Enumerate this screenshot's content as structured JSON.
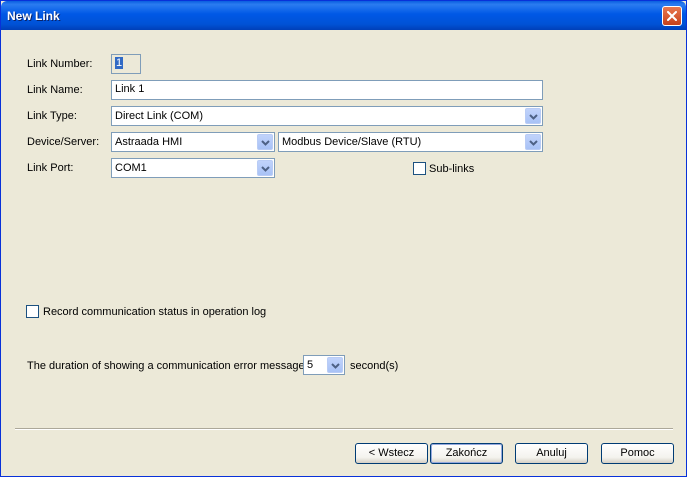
{
  "window": {
    "title": "New Link"
  },
  "form": {
    "link_number": {
      "label": "Link Number:",
      "value": "1"
    },
    "link_name": {
      "label": "Link Name:",
      "value": "Link 1"
    },
    "link_type": {
      "label": "Link Type:",
      "value": "Direct Link (COM)"
    },
    "device_server": {
      "label": "Device/Server:",
      "device": "Astraada HMI",
      "protocol": "Modbus Device/Slave (RTU)"
    },
    "link_port": {
      "label": "Link Port:",
      "value": "COM1"
    },
    "sub_links": {
      "label": "Sub-links",
      "checked": false
    },
    "record_status": {
      "label": "Record communication status in operation log",
      "checked": false
    },
    "error_duration": {
      "label": "The duration of showing a communication error message:",
      "value": "5",
      "unit": "second(s)"
    }
  },
  "buttons": {
    "back": "< Wstecz",
    "finish": "Zakończ",
    "cancel": "Anuluj",
    "help": "Pomoc"
  },
  "icons": {
    "close": "close-icon",
    "dropdown": "chevron-down-icon"
  },
  "colors": {
    "titlebar": "#0058e6",
    "dialog_bg": "#ece9d8",
    "close": "#c8411b"
  }
}
